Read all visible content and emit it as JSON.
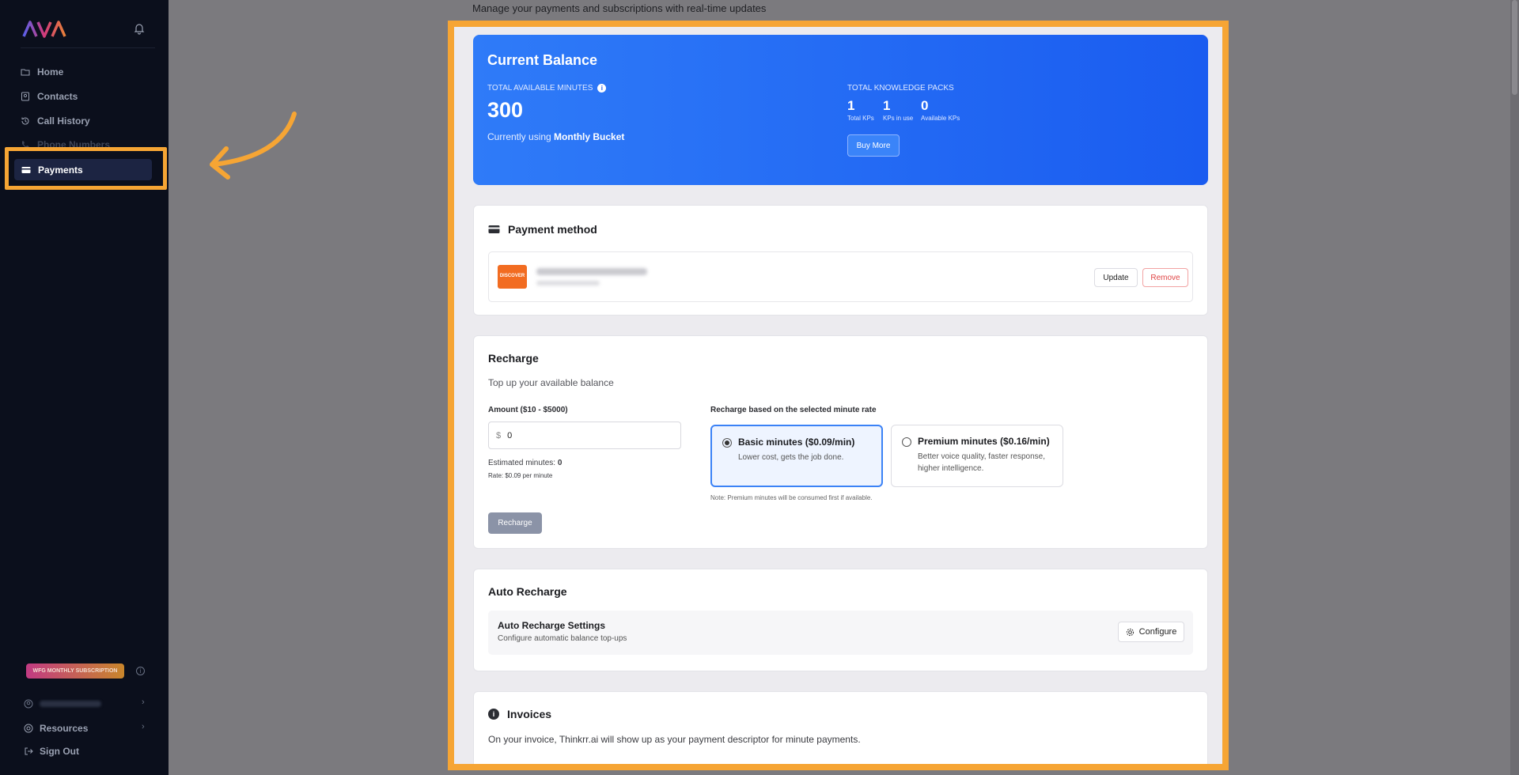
{
  "app": {
    "logo_text": "AVA"
  },
  "sidebar": {
    "items": [
      {
        "label": "Home",
        "icon": "folder-icon"
      },
      {
        "label": "Contacts",
        "icon": "contacts-icon"
      },
      {
        "label": "Call History",
        "icon": "history-icon"
      },
      {
        "label": "Phone Numbers",
        "icon": "phone-icon"
      },
      {
        "label": "Payments",
        "icon": "card-icon",
        "active": true
      }
    ],
    "subscription_badge": "WFG MONTHLY SUBSCRIPTION",
    "resources": "Resources",
    "sign_out": "Sign Out"
  },
  "page": {
    "subtitle": "Manage your payments and subscriptions with real-time updates"
  },
  "balance": {
    "title": "Current Balance",
    "minutes_label": "TOTAL AVAILABLE MINUTES",
    "minutes_value": "300",
    "using_prefix": "Currently using",
    "using_bucket": "Monthly Bucket",
    "kp_label": "TOTAL KNOWLEDGE PACKS",
    "kps": [
      {
        "value": "1",
        "label": "Total KPs"
      },
      {
        "value": "1",
        "label": "KPs in use"
      },
      {
        "value": "0",
        "label": "Available KPs"
      }
    ],
    "buy_more": "Buy More"
  },
  "payment_method": {
    "title": "Payment method",
    "card_brand": "DISCOVER",
    "update": "Update",
    "remove": "Remove"
  },
  "recharge": {
    "title": "Recharge",
    "subtitle": "Top up your available balance",
    "amount_label": "Amount ($10 - $5000)",
    "currency": "$",
    "amount_value": "0",
    "estimated_label": "Estimated minutes:",
    "estimated_value": "0",
    "rate_text": "Rate: $0.09 per minute",
    "rate_section_label": "Recharge based on the selected minute rate",
    "options": [
      {
        "title": "Basic minutes ($0.09/min)",
        "desc": "Lower cost, gets the job done.",
        "selected": true
      },
      {
        "title": "Premium minutes ($0.16/min)",
        "desc": "Better voice quality, faster response, higher intelligence.",
        "selected": false
      }
    ],
    "note": "Note: Premium minutes will be consumed first if available.",
    "button": "Recharge"
  },
  "auto_recharge": {
    "title": "Auto Recharge",
    "settings_title": "Auto Recharge Settings",
    "settings_desc": "Configure automatic balance top-ups",
    "configure": "Configure"
  },
  "invoices": {
    "title": "Invoices",
    "text": "On your invoice, Thinkrr.ai will show up as your payment descriptor for minute payments."
  },
  "colors": {
    "highlight": "#f6a534",
    "balance_blue": "#1a5cf0",
    "sidebar_bg": "#0b0f1c"
  }
}
